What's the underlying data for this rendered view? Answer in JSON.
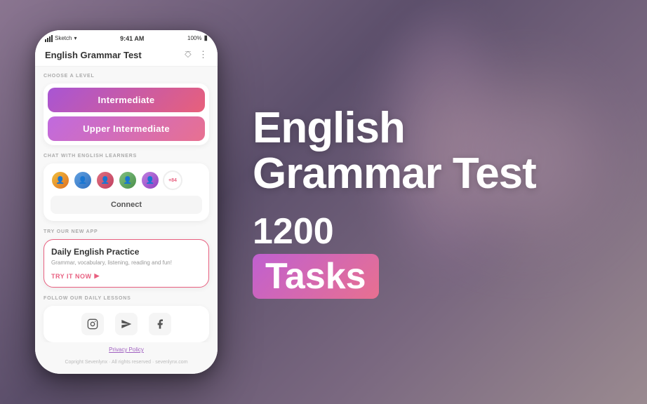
{
  "background": {
    "gradient": "linear-gradient(135deg, #8a7590 0%, #5c4f6b 40%, #7a6880 70%, #9a8a90 100%)"
  },
  "phone": {
    "status_bar": {
      "carrier": "Sketch",
      "time": "9:41 AM",
      "battery": "100%"
    },
    "header": {
      "title": "English Grammar Test",
      "share_icon": "share",
      "more_icon": "more"
    },
    "level_section": {
      "label": "CHOOSE A LEVEL",
      "buttons": [
        {
          "text": "Intermediate",
          "style": "intermediate"
        },
        {
          "text": "Upper Intermediate",
          "style": "upper-intermediate"
        }
      ]
    },
    "chat_section": {
      "label": "CHAT WITH ENGLISH LEARNERS",
      "avatars_count": "+84",
      "connect_button": "Connect"
    },
    "try_app_section": {
      "label": "TRY OUR NEW APP",
      "title": "Daily English Practice",
      "description": "Grammar, vocabulary, listening, reading and fun!",
      "cta": "TRY IT NOW"
    },
    "follow_section": {
      "label": "FOLLOW OUR DAILY LESSONS",
      "socials": [
        "instagram",
        "telegram",
        "facebook"
      ]
    },
    "footer": {
      "privacy": "Privacy Policy",
      "copyright": "Copright Sevenlynx · All rights reserved · sevenlynx.com"
    }
  },
  "right": {
    "title_line1": "English",
    "title_line2": "Grammar Test",
    "number": "1200",
    "tasks_label": "Tasks"
  }
}
